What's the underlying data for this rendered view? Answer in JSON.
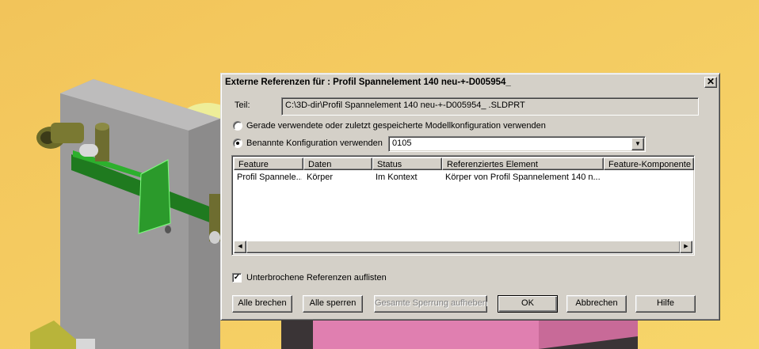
{
  "colors": {
    "background_yellow": "#f5c95a",
    "dialog_face": "#d4d0c8",
    "part_gray": "#a9a8a8",
    "selection_green": "#1f9a1f",
    "magenta_body": "#e07fb0"
  },
  "dialog": {
    "title": "Externe Referenzen für : Profil Spannelement 140 neu-+-D005954_",
    "close_icon": "close-icon",
    "part_label": "Teil:",
    "part_path": "C:\\3D-dir\\Profil Spannelement 140 neu-+-D005954_ .SLDPRT",
    "radio_recent_label": "Gerade verwendete oder zuletzt gespeicherte Modellkonfiguration verwenden",
    "radio_named_label": "Benannte Konfiguration verwenden",
    "config_value": "0105",
    "table": {
      "columns": [
        "Feature",
        "Daten",
        "Status",
        "Referenziertes Element",
        "Feature-Komponente"
      ],
      "rows": [
        [
          "Profil Spannele...",
          "Körper",
          "Im Kontext",
          "Körper von Profil Spannelement 140 n...",
          ""
        ]
      ]
    },
    "checkbox_label": "Unterbrochene Referenzen auflisten",
    "buttons": {
      "break_all": "Alle brechen",
      "lock_all": "Alle sperren",
      "unlock_all": "Gesamte Sperrung aufheben",
      "ok": "OK",
      "cancel": "Abbrechen",
      "help": "Hilfe"
    }
  }
}
